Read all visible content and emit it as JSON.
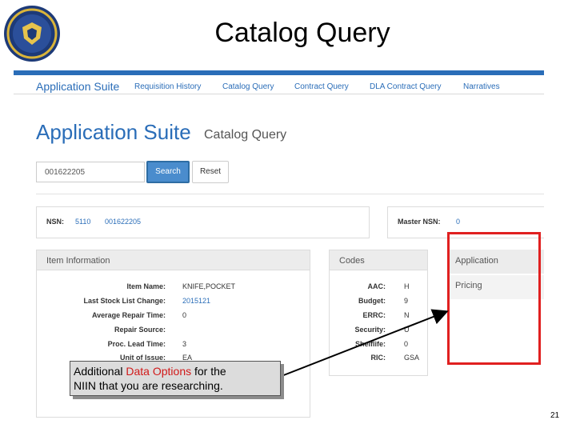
{
  "slide": {
    "title": "Catalog Query",
    "page_number": "21"
  },
  "navbar": {
    "brand": "Application Suite",
    "links": [
      "Requisition History",
      "Catalog Query",
      "Contract Query",
      "DLA Contract Query",
      "Narratives"
    ]
  },
  "header": {
    "title": "Application Suite",
    "subtitle": "Catalog Query"
  },
  "search": {
    "value": "001622205",
    "button": "Search",
    "reset": "Reset"
  },
  "nsn": {
    "label": "NSN:",
    "fsc": "5110",
    "niin": "001622205",
    "master_label": "Master NSN:",
    "master_value": "0"
  },
  "item_information": {
    "heading": "Item Information",
    "rows": [
      {
        "label": "Item Name:",
        "value": "KNIFE,POCKET"
      },
      {
        "label": "Last Stock List Change:",
        "value": "2015121"
      },
      {
        "label": "Average Repair Time:",
        "value": "0"
      },
      {
        "label": "Repair Source:",
        "value": ""
      },
      {
        "label": "Proc. Lead Time:",
        "value": "3"
      },
      {
        "label": "Unit of Issue:",
        "value": "EA"
      }
    ]
  },
  "codes": {
    "heading": "Codes",
    "rows": [
      {
        "label": "AAC:",
        "value": "H"
      },
      {
        "label": "Budget:",
        "value": "9"
      },
      {
        "label": "ERRC:",
        "value": "N"
      },
      {
        "label": "Security:",
        "value": "U"
      },
      {
        "label": "Shelflife:",
        "value": "0"
      },
      {
        "label": "RIC:",
        "value": "GSA"
      }
    ]
  },
  "application": {
    "heading": "Application",
    "items": [
      "Pricing"
    ]
  },
  "callout": {
    "prefix": "Additional ",
    "highlight": "Data Options",
    "suffix": " for the",
    "line2": "NIIN that you are researching."
  },
  "colors": {
    "accent": "#2a6db8",
    "highlight_box": "#e02020",
    "callout_highlight": "#d11919"
  }
}
